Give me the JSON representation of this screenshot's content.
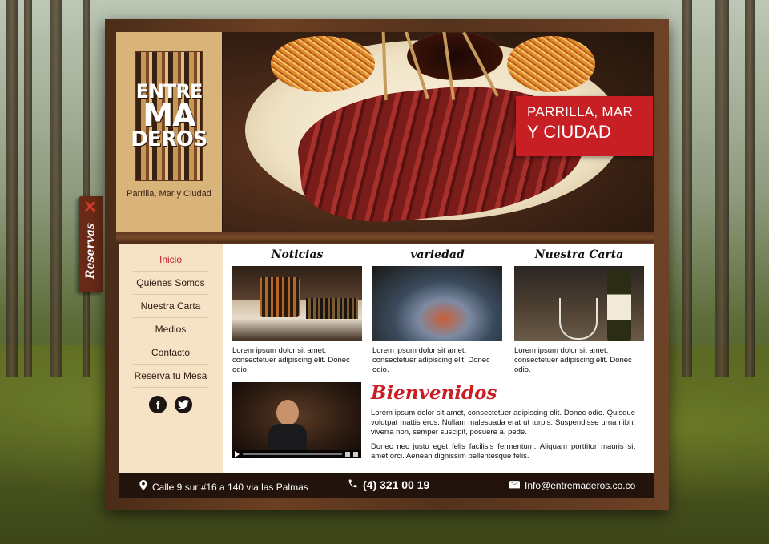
{
  "brand": {
    "logo_lines": [
      "ENTRE",
      "MA",
      "DEROS"
    ],
    "tagline": "Parrilla, Mar y Ciudad"
  },
  "hero": {
    "banner_line1": "PARRILLA, MAR",
    "banner_line2": "Y CIUDAD"
  },
  "reservas_tab": {
    "label": "Reservas",
    "close_glyph": "✕"
  },
  "nav": {
    "items": [
      {
        "label": "Inicio",
        "active": true
      },
      {
        "label": "Quiénes Somos",
        "active": false
      },
      {
        "label": "Nuestra Carta",
        "active": false
      },
      {
        "label": "Medios",
        "active": false
      },
      {
        "label": "Contacto",
        "active": false
      },
      {
        "label": "Reserva tu Mesa",
        "active": false
      }
    ],
    "social": [
      {
        "glyph": "f",
        "icon": "facebook-icon"
      },
      {
        "glyph": "t",
        "icon": "twitter-icon"
      }
    ]
  },
  "columns": [
    {
      "title": "Noticias",
      "text": "Lorem ipsum dolor sit amet, consectetuer adipiscing elit. Donec odio."
    },
    {
      "title": "variedad",
      "text": "Lorem ipsum dolor sit amet, consectetuer adipiscing elit. Donec odio."
    },
    {
      "title": "Nuestra Carta",
      "text": "Lorem ipsum dolor sit amet, consectetuer adipiscing elit. Donec odio."
    }
  ],
  "welcome": {
    "title": "Bienvenidos",
    "p1": "Lorem ipsum dolor sit amet, consectetuer adipiscing elit. Donec odio. Quisque volutpat mattis eros. Nullam malesuada erat ut turpis. Suspendisse urna nibh, viverra non, semper suscipit, posuere a, pede.",
    "p2": "Donec nec justo eget felis facilisis fermentum. Aliquam porttitor mauris sit amet orci. Aenean dignissim pellentesque felis."
  },
  "footer": {
    "address": "Calle 9 sur #16 a 140 via las Palmas",
    "phone": "(4) 321 00 19",
    "email": "Info@entremaderos.co.co"
  },
  "colors": {
    "accent": "#c81f24",
    "footer_bg": "#22140d",
    "nav_bg": "#f6e3c6",
    "logo_bg": "#d9b47a"
  }
}
